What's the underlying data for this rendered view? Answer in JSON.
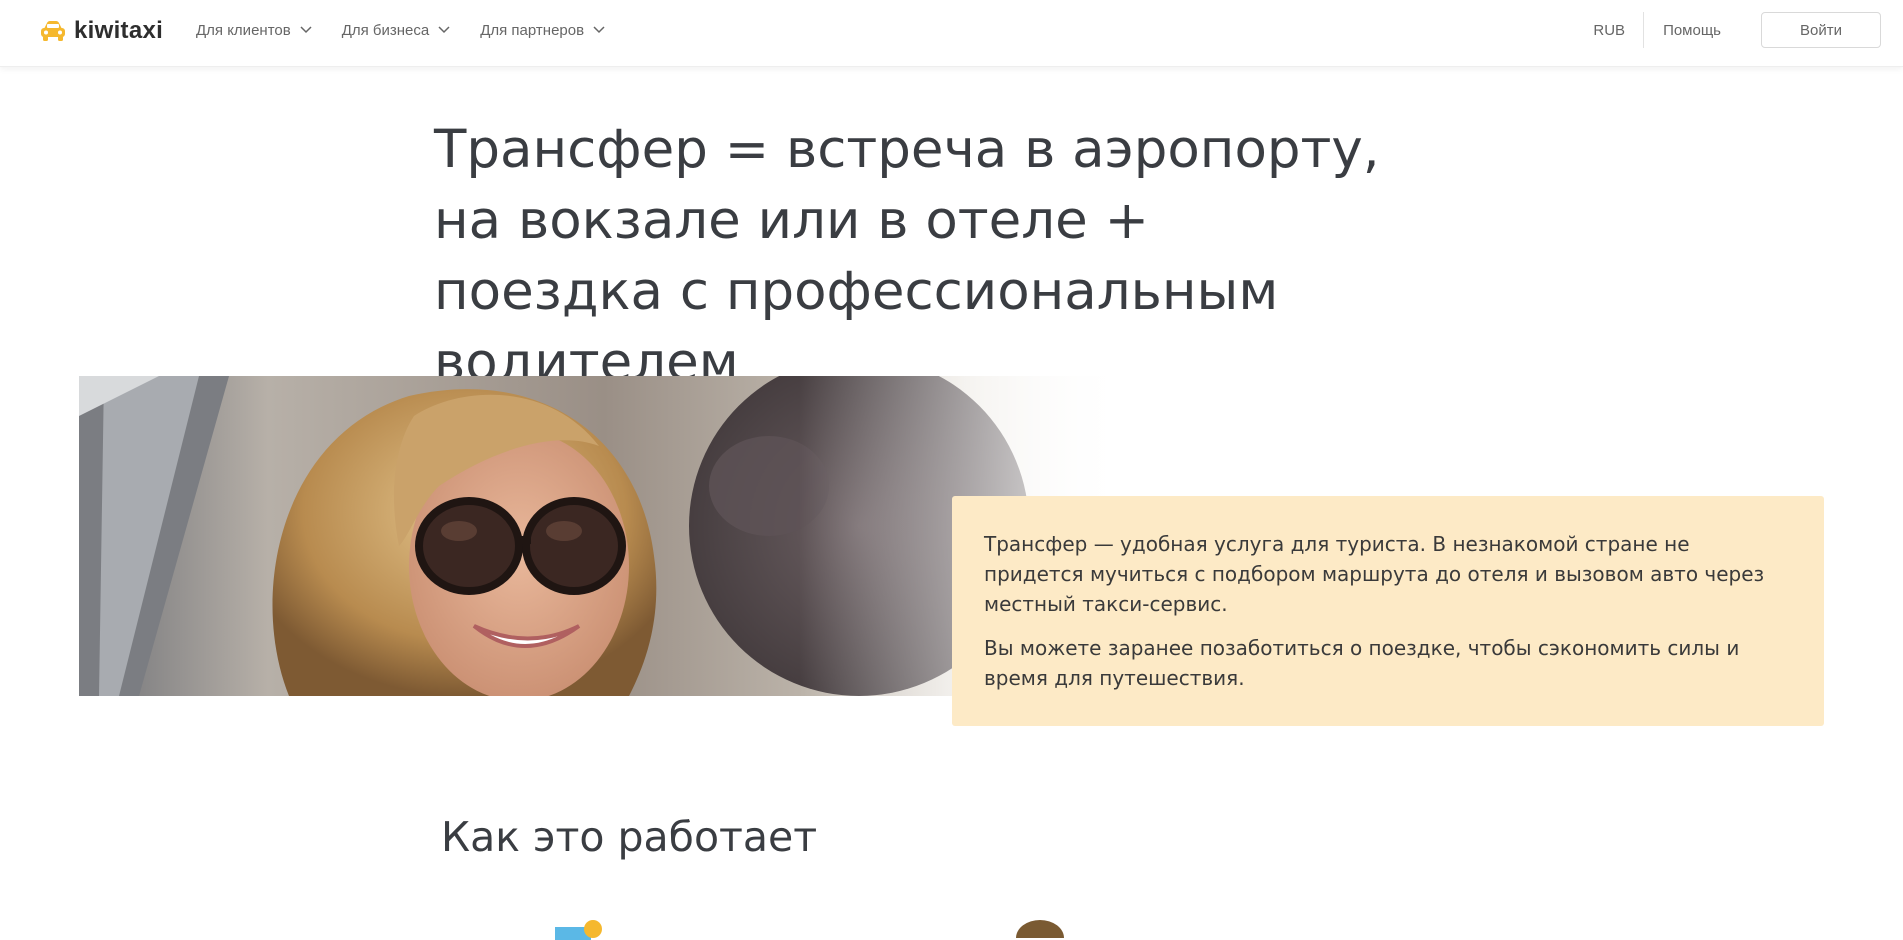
{
  "header": {
    "logo_text": "kiwitaxi",
    "logo_icon": "taxi-car-icon",
    "nav": [
      {
        "label": "Для клиентов",
        "icon": "chevron-down-icon"
      },
      {
        "label": "Для бизнеса",
        "icon": "chevron-down-icon"
      },
      {
        "label": "Для партнеров",
        "icon": "chevron-down-icon"
      }
    ],
    "currency": "RUB",
    "help": "Помощь",
    "login": "Войти"
  },
  "hero": {
    "title": "Трансфер = встреча в аэропорту, на вокзале или в отеле + поездка с профессиональным водителем"
  },
  "info": {
    "paragraphs": [
      "Трансфер — удобная услуга для туриста. В незнакомой стране не придется мучиться с подбором маршрута до отеля и вызовом авто через местный такси-сервис.",
      "Вы можете заранее позаботиться о поездке, чтобы сэкономить силы и время для путешествия."
    ]
  },
  "how": {
    "title": "Как это работает"
  },
  "colors": {
    "accent": "#f5b82e",
    "card_bg": "#fdeac6",
    "text": "#3a3d42"
  }
}
